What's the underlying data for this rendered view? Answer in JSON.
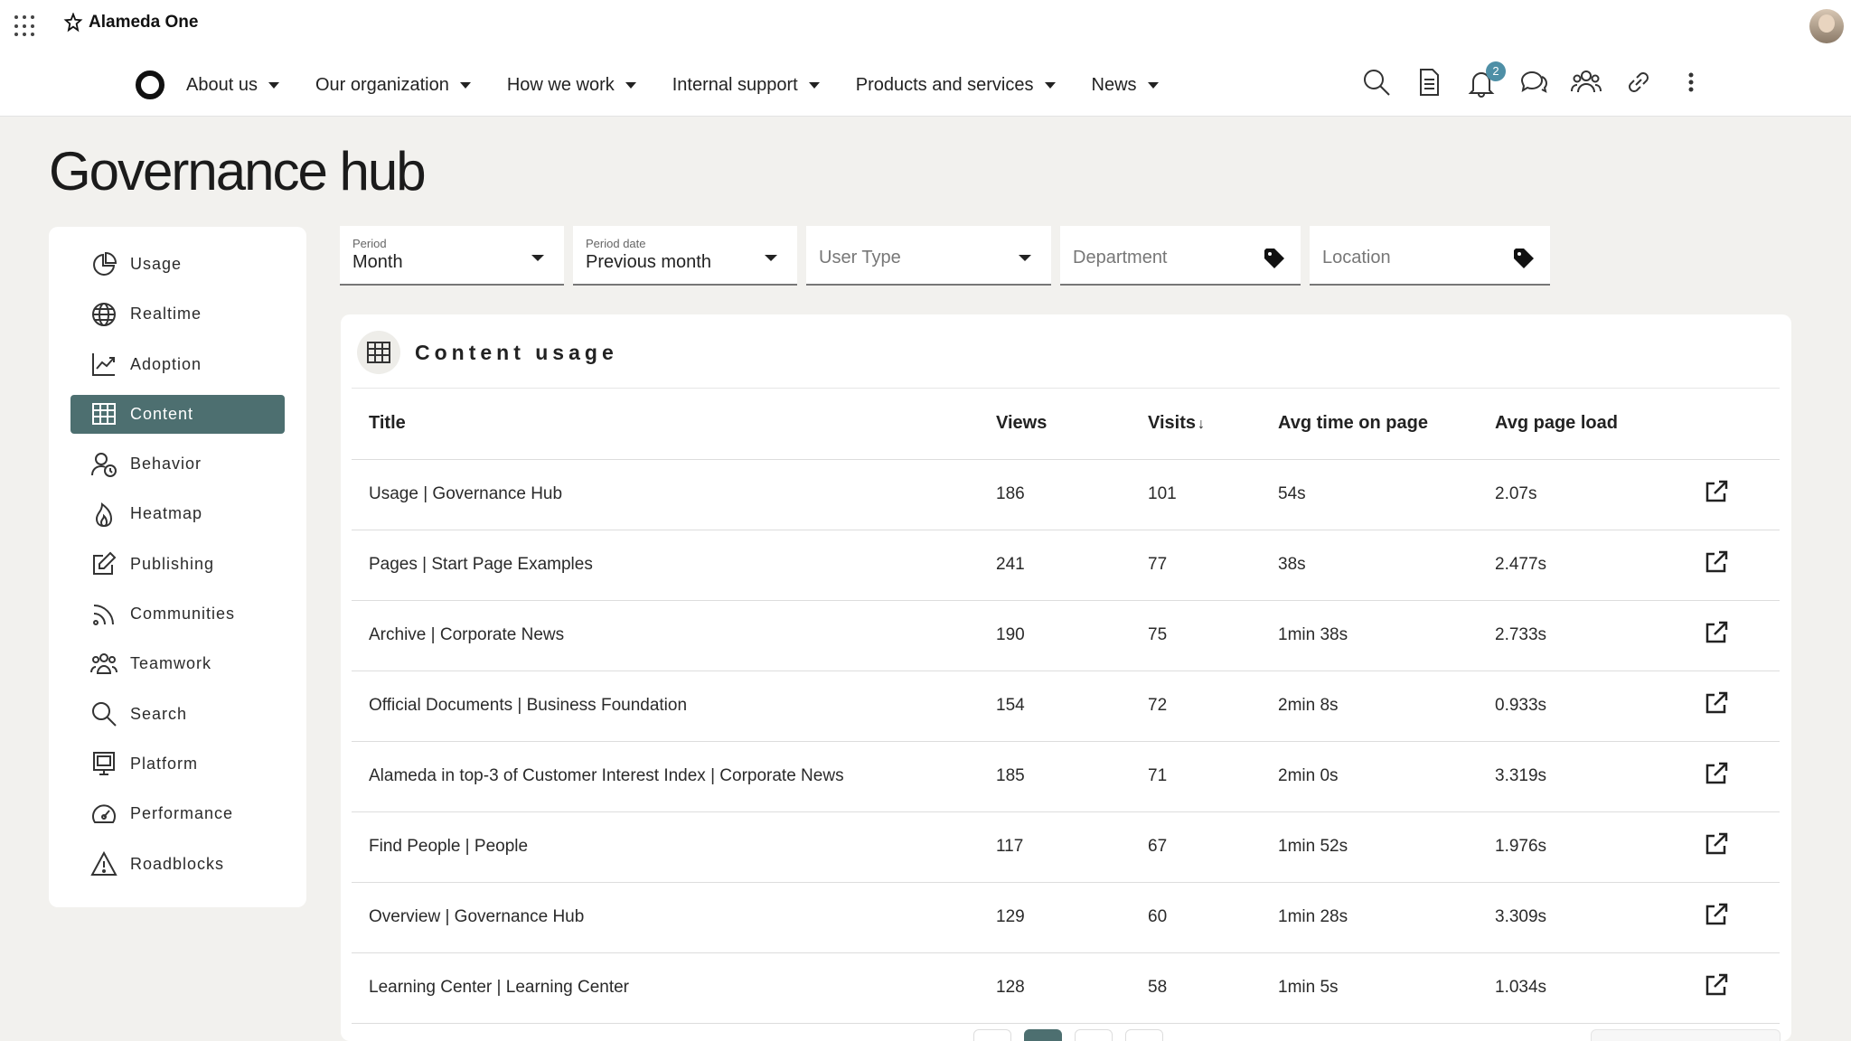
{
  "app": {
    "name": "Alameda One"
  },
  "nav": {
    "items": [
      {
        "label": "About us"
      },
      {
        "label": "Our organization"
      },
      {
        "label": "How we work"
      },
      {
        "label": "Internal support"
      },
      {
        "label": "Products and services"
      },
      {
        "label": "News"
      }
    ],
    "notification_count": "2"
  },
  "page": {
    "title": "Governance hub"
  },
  "sidebar": {
    "items": [
      {
        "label": "Usage",
        "icon": "pie-chart-icon"
      },
      {
        "label": "Realtime",
        "icon": "globe-icon"
      },
      {
        "label": "Adoption",
        "icon": "trend-chart-icon"
      },
      {
        "label": "Content",
        "icon": "table-grid-icon",
        "active": true
      },
      {
        "label": "Behavior",
        "icon": "user-clock-icon"
      },
      {
        "label": "Heatmap",
        "icon": "flame-icon"
      },
      {
        "label": "Publishing",
        "icon": "edit-icon"
      },
      {
        "label": "Communities",
        "icon": "rss-icon"
      },
      {
        "label": "Teamwork",
        "icon": "group-icon"
      },
      {
        "label": "Search",
        "icon": "search-icon"
      },
      {
        "label": "Platform",
        "icon": "monitor-icon"
      },
      {
        "label": "Performance",
        "icon": "gauge-icon"
      },
      {
        "label": "Roadblocks",
        "icon": "warning-icon"
      }
    ]
  },
  "filters": {
    "period": {
      "label": "Period",
      "value": "Month"
    },
    "period_date": {
      "label": "Period date",
      "value": "Previous month"
    },
    "user_type": {
      "placeholder": "User Type"
    },
    "department": {
      "placeholder": "Department"
    },
    "location": {
      "placeholder": "Location"
    }
  },
  "card": {
    "title": "Content usage",
    "columns": {
      "title": "Title",
      "views": "Views",
      "visits": "Visits",
      "visits_sort": "↓",
      "avg_time": "Avg time on page",
      "avg_load": "Avg page load"
    },
    "rows": [
      {
        "title": "Usage | Governance Hub",
        "views": "186",
        "visits": "101",
        "avg_time": "54s",
        "avg_load": "2.07s"
      },
      {
        "title": "Pages | Start Page Examples",
        "views": "241",
        "visits": "77",
        "avg_time": "38s",
        "avg_load": "2.477s"
      },
      {
        "title": "Archive | Corporate News",
        "views": "190",
        "visits": "75",
        "avg_time": "1min 38s",
        "avg_load": "2.733s"
      },
      {
        "title": "Official Documents | Business Foundation",
        "views": "154",
        "visits": "72",
        "avg_time": "2min 8s",
        "avg_load": "0.933s"
      },
      {
        "title": "Alameda in top-3 of Customer Interest Index | Corporate News",
        "views": "185",
        "visits": "71",
        "avg_time": "2min 0s",
        "avg_load": "3.319s"
      },
      {
        "title": "Find People | People",
        "views": "117",
        "visits": "67",
        "avg_time": "1min 52s",
        "avg_load": "1.976s"
      },
      {
        "title": "Overview | Governance Hub",
        "views": "129",
        "visits": "60",
        "avg_time": "1min 28s",
        "avg_load": "3.309s"
      },
      {
        "title": "Learning Center | Learning Center",
        "views": "128",
        "visits": "58",
        "avg_time": "1min 5s",
        "avg_load": "1.034s"
      }
    ]
  },
  "colors": {
    "accent": "#4d6f70",
    "badge": "#4e8fa6",
    "background": "#f2f1ee"
  }
}
